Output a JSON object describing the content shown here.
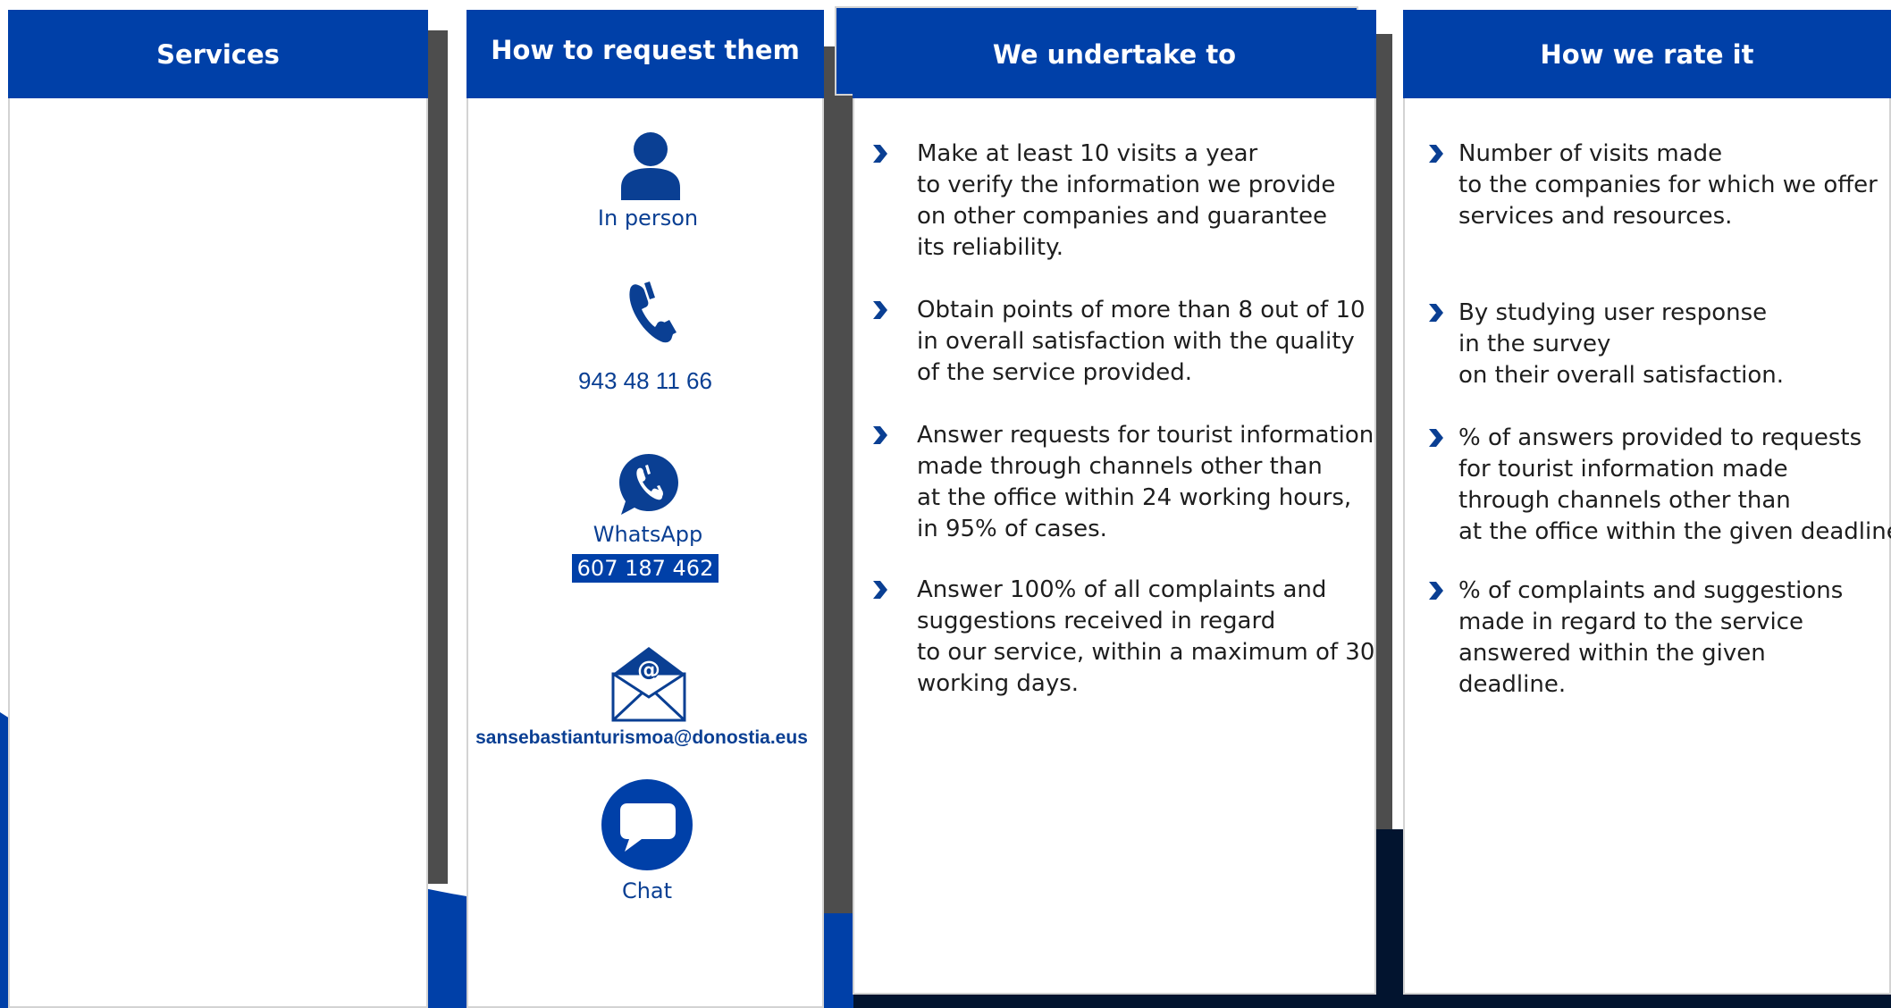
{
  "columns": {
    "services": {
      "title": "Services"
    },
    "request": {
      "title": "How to request them",
      "in_person": "In person",
      "phone": "943 48 11 66",
      "whatsapp_label": "WhatsApp",
      "whatsapp_number": "607 187 462",
      "email": "sansebastianturismoa@donostia.eus",
      "chat": "Chat"
    },
    "undertake": {
      "title": "We undertake to",
      "items": [
        "Make at least 10 visits a year\nto verify the information we provide\non other companies and guarantee\nits reliability.",
        "Obtain points of more than 8 out of 10\nin overall satisfaction with the quality\nof the service provided.",
        "Answer requests for tourist information\nmade through channels other than\nat the office within 24 working hours,\nin 95% of cases.",
        "Answer 100% of all complaints and\nsuggestions received in regard\nto our service, within a maximum of 30\nworking days."
      ]
    },
    "rate": {
      "title": "How we rate it",
      "items": [
        "Number of visits made\nto the companies for which we offer\nservices and resources.",
        "By studying user response\nin the survey\non their overall satisfaction.",
        "% of answers provided to requests\nfor tourist information made\nthrough channels other than\nat the office within the given deadline.",
        "% of complaints and suggestions\nmade in regard to the service\nanswered within the given\ndeadline."
      ]
    }
  },
  "icons": {
    "person": "person-icon",
    "phone": "phone-icon",
    "whatsapp": "whatsapp-icon",
    "email": "envelope-icon",
    "chat": "chat-bubble-icon",
    "bullet": "chevron-right-icon"
  },
  "colors": {
    "brand_blue": "#0040a8",
    "text_blue": "#0a3f93",
    "navy": "#02142f",
    "shadow": "#4d4d4d"
  }
}
